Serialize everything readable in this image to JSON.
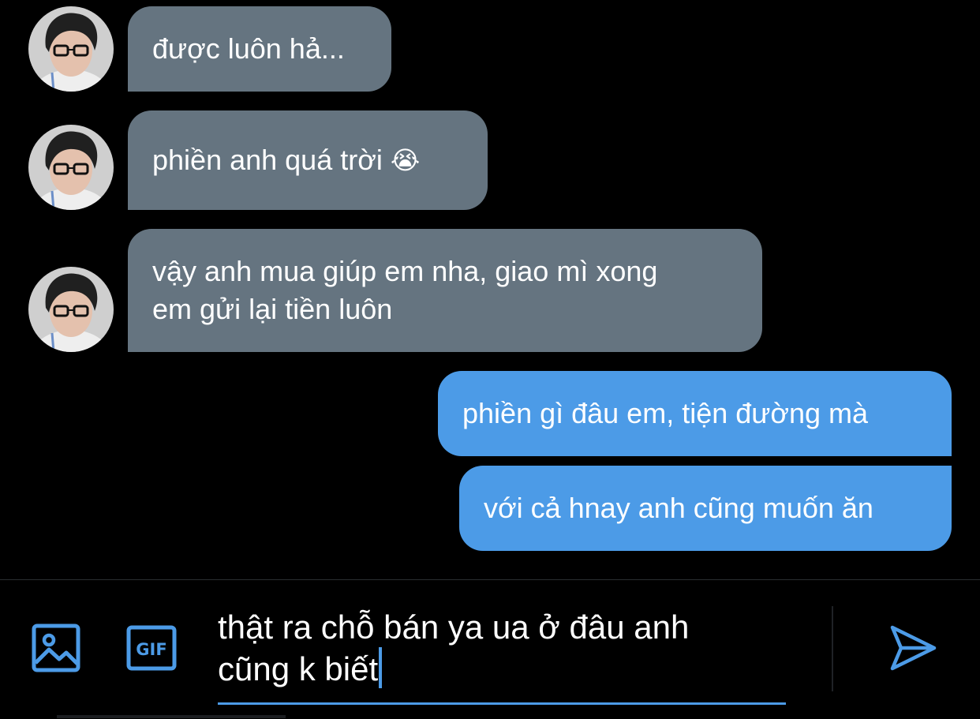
{
  "colors": {
    "background": "#000000",
    "incoming_bubble": "#657480",
    "outgoing_bubble": "#4c9be7",
    "accent": "#4c9be7"
  },
  "messages": [
    {
      "direction": "incoming",
      "text": "được luôn hả..."
    },
    {
      "direction": "incoming",
      "text": "phiền anh quá trời",
      "emoji": "😭"
    },
    {
      "direction": "incoming",
      "text": "vậy anh mua giúp em nha, giao mì xong\nem gửi lại tiền luôn"
    },
    {
      "direction": "outgoing",
      "text": "phiền gì đâu em, tiện đường mà"
    },
    {
      "direction": "outgoing",
      "text": "với cả hnay anh cũng muốn ăn"
    }
  ],
  "composer": {
    "image_icon": "image-icon",
    "gif_icon": "gif-icon",
    "gif_label": "GIF",
    "input_value": "thật ra chỗ bán ya ua ở đâu anh\ncũng k biết",
    "send_icon": "send-icon"
  }
}
